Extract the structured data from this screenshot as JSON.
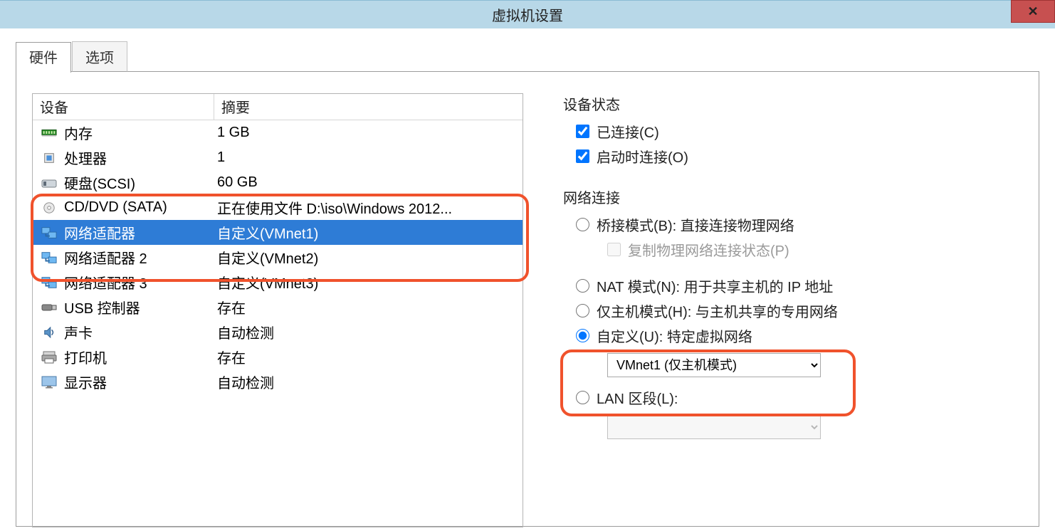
{
  "titlebar": {
    "title": "虚拟机设置"
  },
  "tabs": {
    "hardware": "硬件",
    "options": "选项"
  },
  "device_table": {
    "headers": {
      "device": "设备",
      "summary": "摘要"
    },
    "rows": [
      {
        "icon": "memory",
        "name": "内存",
        "summary": "1 GB"
      },
      {
        "icon": "cpu",
        "name": "处理器",
        "summary": "1"
      },
      {
        "icon": "disk",
        "name": "硬盘(SCSI)",
        "summary": "60 GB"
      },
      {
        "icon": "cd",
        "name": "CD/DVD (SATA)",
        "summary": "正在使用文件 D:\\iso\\Windows 2012..."
      },
      {
        "icon": "net",
        "name": "网络适配器",
        "summary": "自定义(VMnet1)",
        "selected": true
      },
      {
        "icon": "net",
        "name": "网络适配器 2",
        "summary": "自定义(VMnet2)"
      },
      {
        "icon": "net",
        "name": "网络适配器 3",
        "summary": "自定义(VMnet3)"
      },
      {
        "icon": "usb",
        "name": "USB 控制器",
        "summary": "存在"
      },
      {
        "icon": "sound",
        "name": "声卡",
        "summary": "自动检测"
      },
      {
        "icon": "printer",
        "name": "打印机",
        "summary": "存在"
      },
      {
        "icon": "display",
        "name": "显示器",
        "summary": "自动检测"
      }
    ]
  },
  "right": {
    "device_state": {
      "title": "设备状态",
      "connected": "已连接(C)",
      "connect_on_start": "启动时连接(O)"
    },
    "net_conn": {
      "title": "网络连接",
      "bridged": "桥接模式(B): 直接连接物理网络",
      "replicate": "复制物理网络连接状态(P)",
      "nat": "NAT 模式(N): 用于共享主机的 IP 地址",
      "hostonly": "仅主机模式(H): 与主机共享的专用网络",
      "custom": "自定义(U): 特定虚拟网络",
      "custom_selected": "VMnet1 (仅主机模式)",
      "lan_segment": "LAN 区段(L):"
    }
  }
}
